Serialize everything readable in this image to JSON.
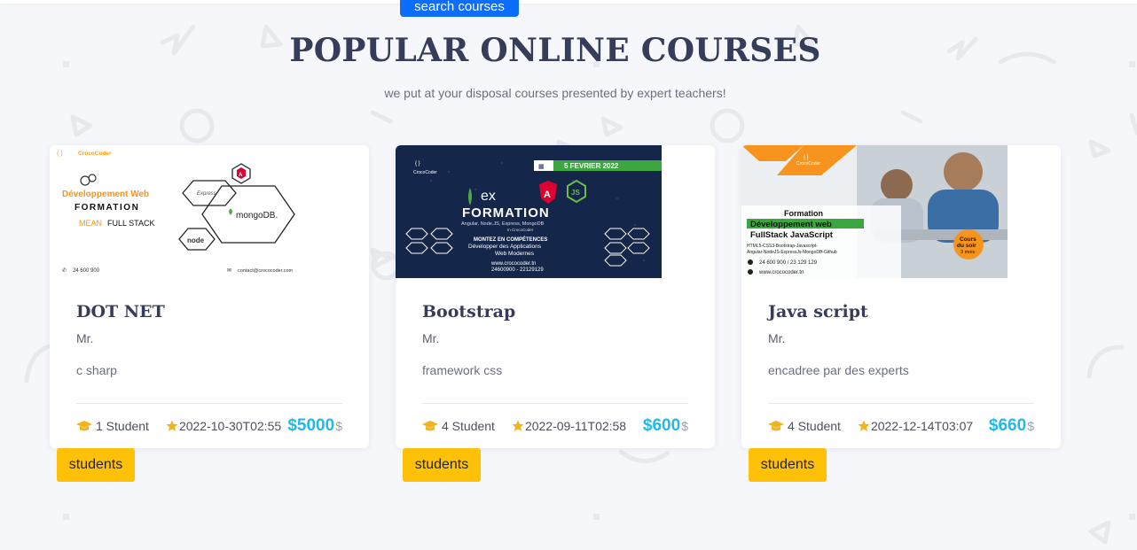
{
  "header": {
    "search_button_label": "search courses",
    "title": "POPULAR ONLINE COURSES",
    "subtitle": "we put at your disposal courses presented by expert teachers!"
  },
  "colors": {
    "title": "#363d5a",
    "price": "#22b8e8",
    "accent_yellow": "#ffc107",
    "primary_blue": "#0d6efd"
  },
  "courses": [
    {
      "name": "DOT NET",
      "teacher": "Mr.",
      "description": "c sharp",
      "students": "1 Student",
      "date": "2022-10-30T02:55",
      "price": "$5000",
      "currency": "$",
      "students_button_label": "students",
      "poster": {
        "brand": "CrocoCoder",
        "line1": "Développement Web",
        "line2": "FORMATION",
        "line3_a": "MEAN",
        "line3_b": "FULL STACK",
        "phone": "24 600 900",
        "email": "contact@crococoder.com",
        "logo_express": "Express",
        "logo_angular": "A",
        "logo_mongo": "mongoDB.",
        "logo_node": "node"
      }
    },
    {
      "name": "Bootstrap",
      "teacher": "Mr.",
      "description": "framework css",
      "students": "4 Student",
      "date": "2022-09-11T02:58",
      "price": "$600",
      "currency": "$",
      "students_button_label": "students",
      "poster": {
        "brand": "CrocoCoder",
        "date": "5 FEVRIER 2022",
        "line1": "FORMATION",
        "line2": "Angular, Node.JS, Express, MongoDB",
        "line3": "In CrocoCoder",
        "line4": "MONTEZ EN COMPÉTENCES",
        "line5": "Développer des Applications",
        "line6": "Web Modernes",
        "site": "www.crococoder.tn",
        "phones": "24600900 - 22129129"
      }
    },
    {
      "name": "Java script",
      "teacher": "Mr.",
      "description": "encadree par des experts",
      "students": "4 Student",
      "date": "2022-12-14T03:07",
      "price": "$660",
      "currency": "$",
      "students_button_label": "students",
      "poster": {
        "brand": "CrocoCoder",
        "line1": "Formation",
        "line2": "Développement web",
        "line3": "FullStack JavaScript",
        "line4": "HTML5-CSS3-Bootstrap-Javascript-",
        "line5": "Angular-NodeJS-ExpressJs-MongoDB-Github",
        "phones": "24 600 900 / 23 129 129",
        "site": "www.crococoder.tn",
        "badge1": "Cours",
        "badge2": "du soir",
        "badge3": "3 mois"
      }
    }
  ]
}
